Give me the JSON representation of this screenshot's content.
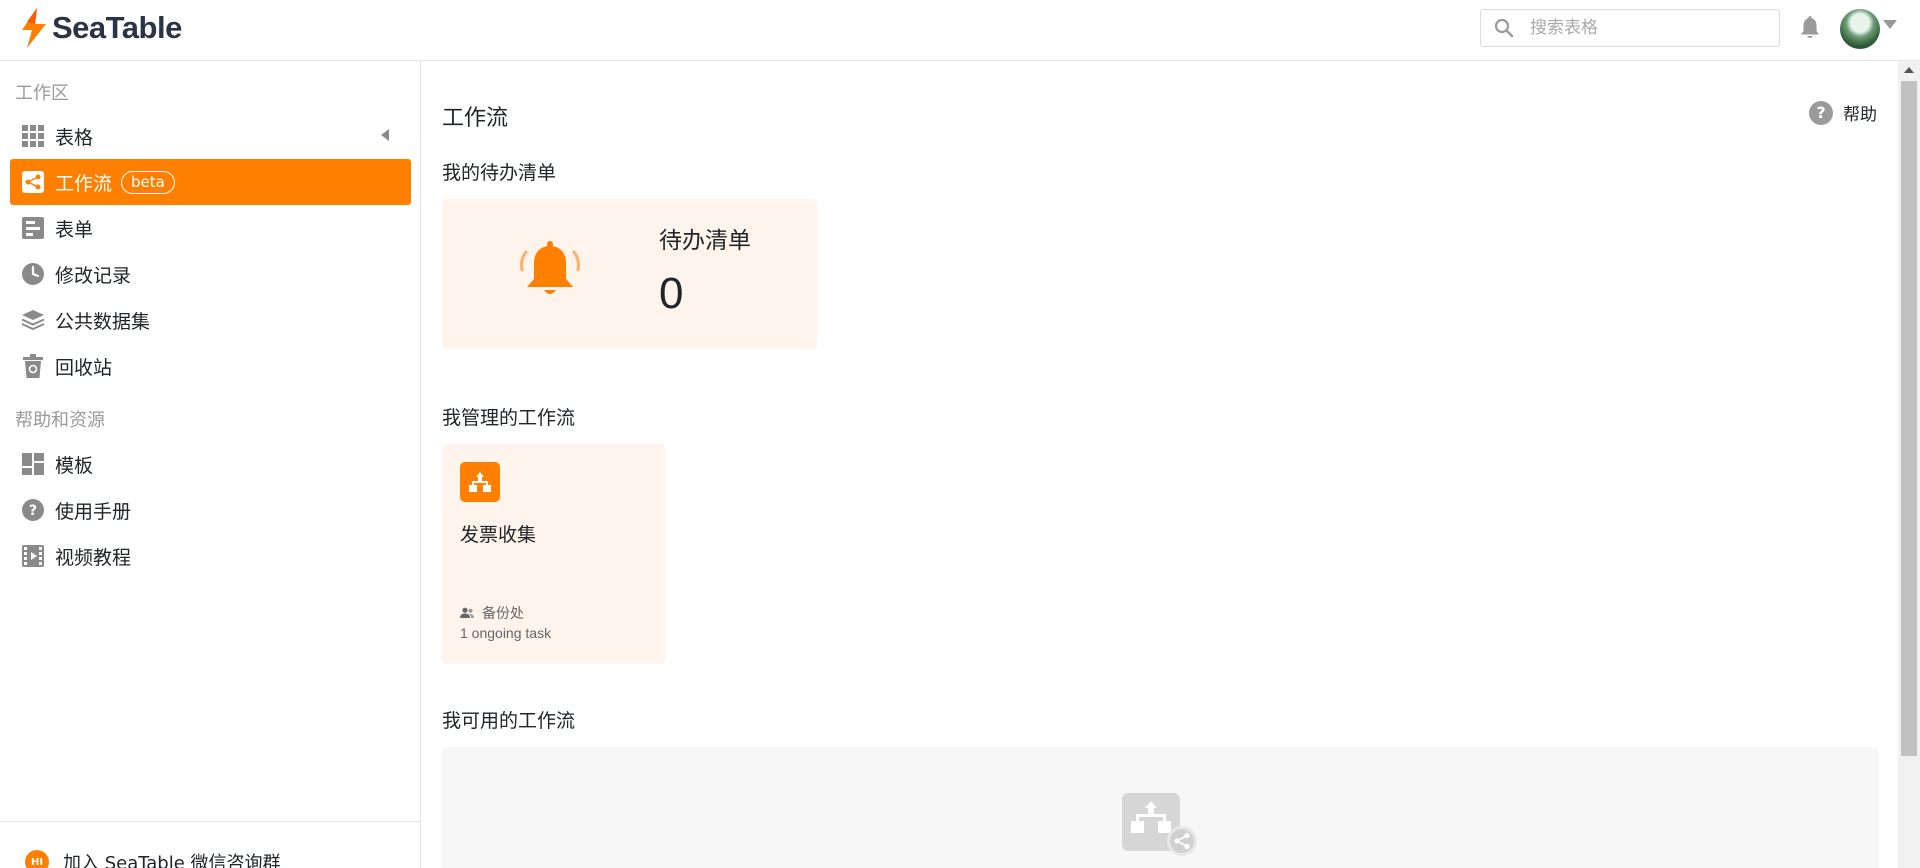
{
  "header": {
    "brand": "SeaTable",
    "search_placeholder": "搜索表格",
    "icons": [
      "search-icon",
      "bell-icon",
      "avatar",
      "caret-down-icon"
    ]
  },
  "sidebar": {
    "workspace_title": "工作区",
    "workspace_items": [
      {
        "label": "表格",
        "icon": "grid-icon"
      },
      {
        "label": "工作流",
        "icon": "workflow-icon",
        "badge": "beta",
        "active": true
      },
      {
        "label": "表单",
        "icon": "form-icon"
      },
      {
        "label": "修改记录",
        "icon": "clock-icon"
      },
      {
        "label": "公共数据集",
        "icon": "layers-icon"
      },
      {
        "label": "回收站",
        "icon": "trash-icon"
      }
    ],
    "resources_title": "帮助和资源",
    "resource_items": [
      {
        "label": "模板",
        "icon": "template-icon"
      },
      {
        "label": "使用手册",
        "icon": "help-circle-icon"
      },
      {
        "label": "视频教程",
        "icon": "video-icon"
      }
    ],
    "footer_label": "加入 SeaTable 微信咨询群",
    "footer_icon_text": "HI"
  },
  "main": {
    "title": "工作流",
    "help_label": "帮助",
    "todo_section": "我的待办清单",
    "todo_card": {
      "title": "待办清单",
      "count": "0"
    },
    "managed_section": "我管理的工作流",
    "workflow_card": {
      "name": "发票收集",
      "owner": "备份处",
      "tasks": "1 ongoing task"
    },
    "available_section": "我可用的工作流"
  },
  "colors": {
    "accent": "#ff8000",
    "card_bg": "#fff4eb",
    "muted": "#9a9a9a"
  }
}
